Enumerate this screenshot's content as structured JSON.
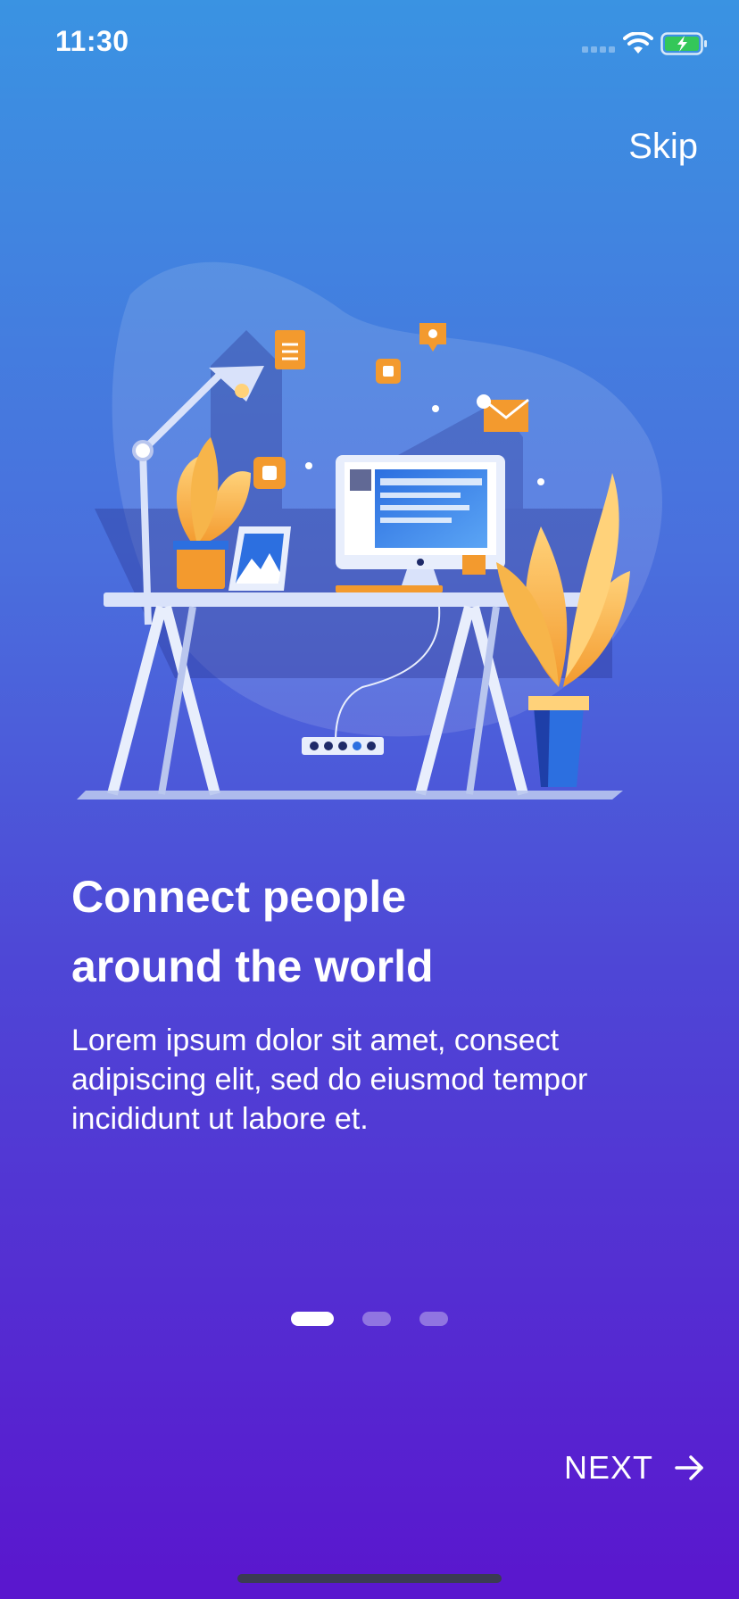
{
  "status_bar": {
    "time": "11:30",
    "icons": [
      "signal-icon",
      "wifi-icon",
      "battery-charging-icon"
    ],
    "battery_color": "#34C759"
  },
  "header": {
    "skip_label": "Skip"
  },
  "illustration": {
    "name": "workspace-desk-illustration"
  },
  "content": {
    "title_line1": "Connect people",
    "title_line2": "around the world",
    "description_line1": "Lorem ipsum dolor sit amet, consect",
    "description_line2": "adipiscing elit, sed do eiusmod tempor",
    "description_line3": "incididunt ut labore et."
  },
  "pager": {
    "total": 3,
    "active_index": 0
  },
  "footer": {
    "next_label": "NEXT",
    "next_icon": "arrow-right-icon"
  },
  "colors": {
    "gradient_top": "#3A93E2",
    "gradient_bottom": "#5A16CE",
    "text": "#FFFFFF",
    "accent_orange": "#F39A2E"
  }
}
